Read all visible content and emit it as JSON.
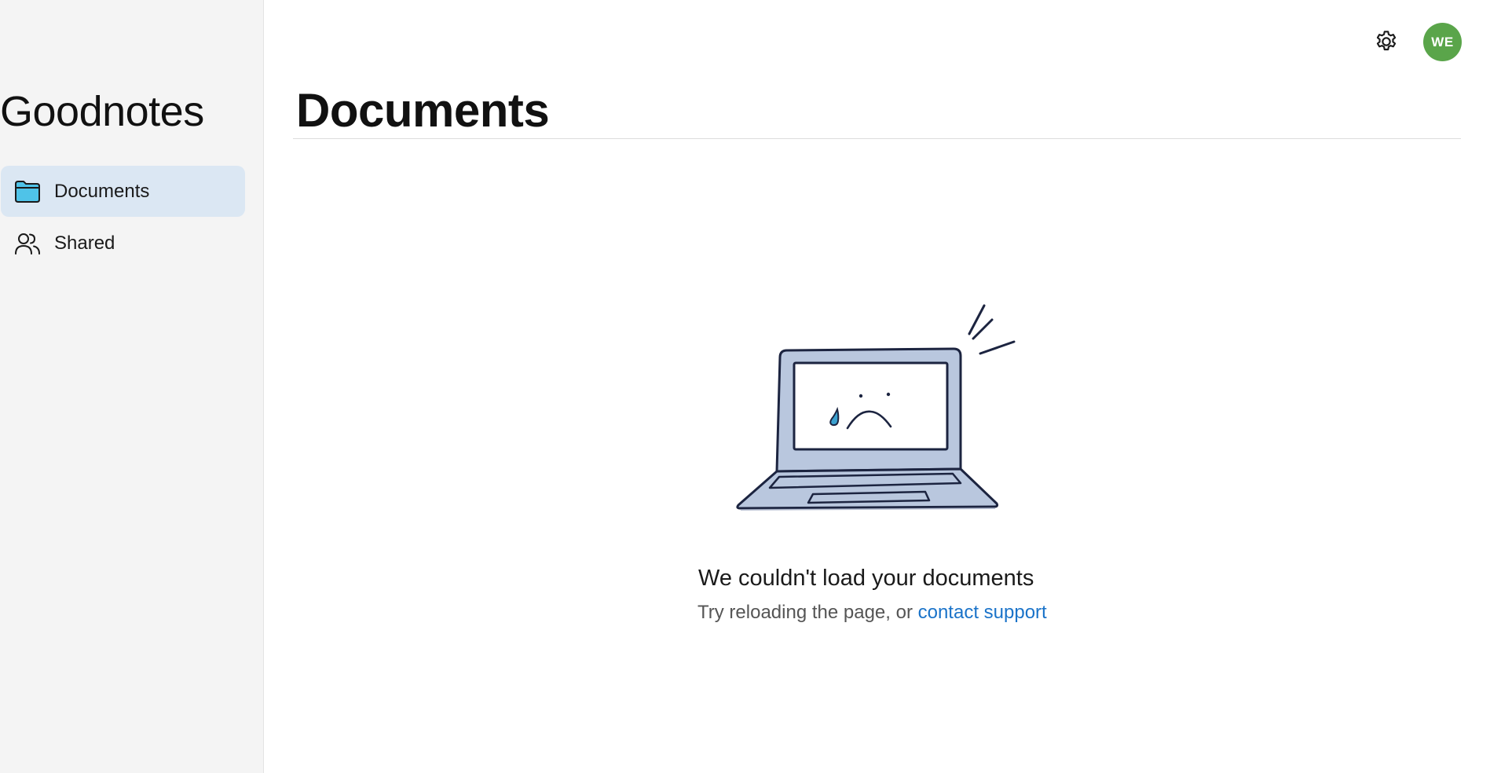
{
  "sidebar": {
    "brand": "Goodnotes",
    "items": [
      {
        "label": "Documents",
        "icon": "folder-icon",
        "active": true
      },
      {
        "label": "Shared",
        "icon": "people-icon",
        "active": false
      }
    ]
  },
  "header": {
    "settings_icon": "gear-icon",
    "avatar_initials": "WE",
    "avatar_color": "#5aa54a"
  },
  "main": {
    "title": "Documents",
    "empty_state": {
      "illustration": "sad-laptop-illustration",
      "title": "We couldn't load your documents",
      "subtitle_prefix": "Try reloading the page, or ",
      "support_link": "contact support"
    }
  },
  "colors": {
    "sidebar_bg": "#f4f4f4",
    "active_item_bg": "#dbe7f3",
    "link": "#1a73c9",
    "folder_fill": "#4fc3e8"
  }
}
